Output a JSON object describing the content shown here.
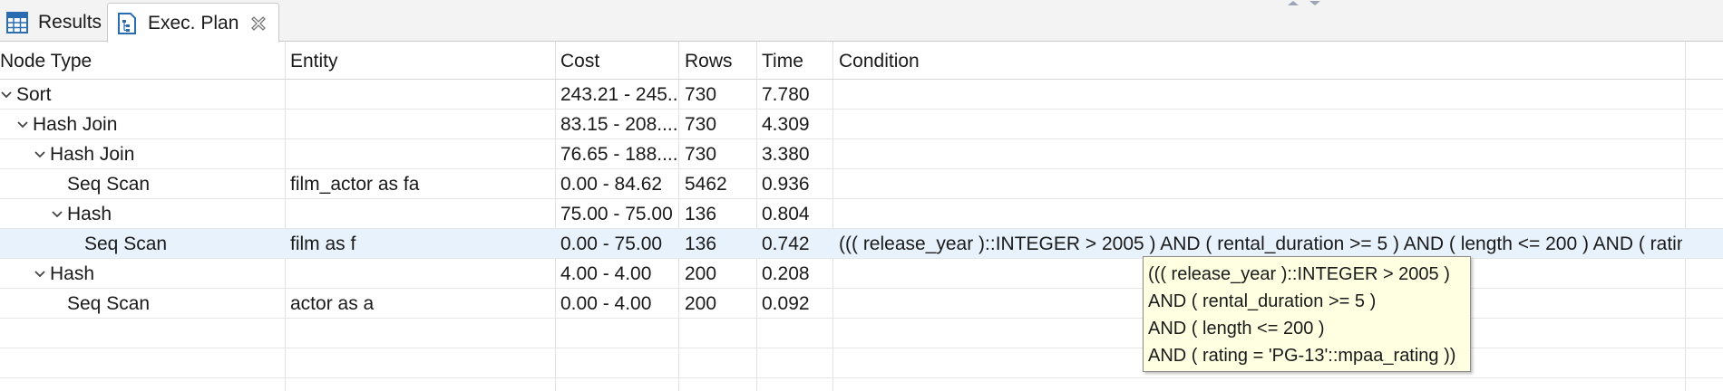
{
  "tabs": [
    {
      "label": "Results",
      "icon": "grid-table-icon"
    },
    {
      "label": "Exec. Plan",
      "icon": "exec-plan-icon",
      "active": true
    }
  ],
  "columns": [
    "Node Type",
    "Entity",
    "Cost",
    "Rows",
    "Time",
    "Condition"
  ],
  "rows": [
    {
      "node": "Sort",
      "entity": "",
      "cost": "243.21 - 245....",
      "rows": "730",
      "time": "7.780",
      "condition": ""
    },
    {
      "node": "Hash Join",
      "entity": "",
      "cost": "83.15 - 208....",
      "rows": "730",
      "time": "4.309",
      "condition": ""
    },
    {
      "node": "Hash Join",
      "entity": "",
      "cost": "76.65 - 188....",
      "rows": "730",
      "time": "3.380",
      "condition": ""
    },
    {
      "node": "Seq Scan",
      "entity": "film_actor as fa",
      "cost": "0.00 - 84.62",
      "rows": "5462",
      "time": "0.936",
      "condition": ""
    },
    {
      "node": "Hash",
      "entity": "",
      "cost": "75.00 - 75.00",
      "rows": "136",
      "time": "0.804",
      "condition": ""
    },
    {
      "node": "Seq Scan",
      "entity": "film as f",
      "cost": "0.00 - 75.00",
      "rows": "136",
      "time": "0.742",
      "condition": "((( release_year )::INTEGER > 2005 ) AND ( rental_duration >= 5 ) AND ( length <= 200 ) AND ( ratin..."
    },
    {
      "node": "Hash",
      "entity": "",
      "cost": "4.00 - 4.00",
      "rows": "200",
      "time": "0.208",
      "condition": ""
    },
    {
      "node": "Seq Scan",
      "entity": "actor as a",
      "cost": "0.00 - 4.00",
      "rows": "200",
      "time": "0.092",
      "condition": ""
    }
  ],
  "tooltip": {
    "lines": [
      "((( release_year )::INTEGER > 2005 )",
      "AND ( rental_duration >= 5 )",
      "AND ( length <= 200 )",
      "AND ( rating = 'PG-13'::mpaa_rating ))"
    ]
  },
  "colors": {
    "selected_row": "#e8f2fc",
    "tooltip_bg": "#ffffe1",
    "icon_blue": "#2b6cb0"
  }
}
